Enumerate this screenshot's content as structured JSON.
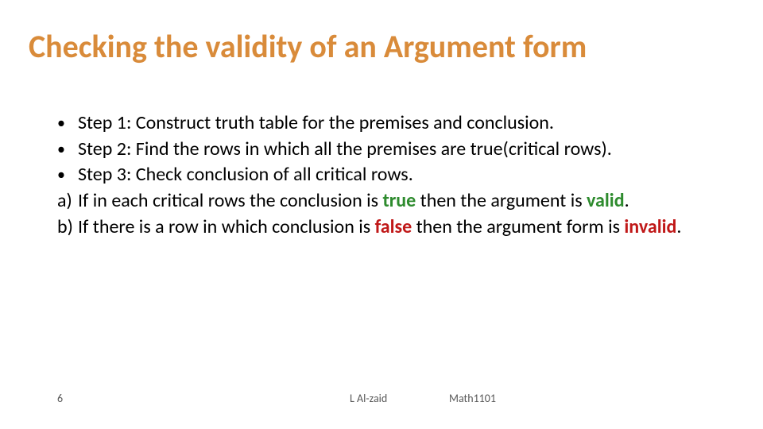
{
  "title": "Checking the validity of an Argument form",
  "bullets": {
    "step1": "Step 1: Construct truth table for the premises and conclusion.",
    "step2": "Step 2: Find the rows in which all the premises are true(critical rows).",
    "step3": "Step 3: Check conclusion of all critical rows.",
    "a_pre": "If in each critical rows the conclusion is ",
    "a_true": "true",
    "a_mid": " then the argument is ",
    "a_valid": "valid",
    "a_end": ".",
    "b_pre": "If there is a row in which conclusion is ",
    "b_false": "false",
    "b_mid": " then the argument form is ",
    "b_invalid": "invalid",
    "b_end": "."
  },
  "markers": {
    "dot": "•",
    "a": "a)",
    "b": "b)"
  },
  "footer": {
    "page": "6",
    "author": "L Al-zaid",
    "course": "Math1101"
  }
}
